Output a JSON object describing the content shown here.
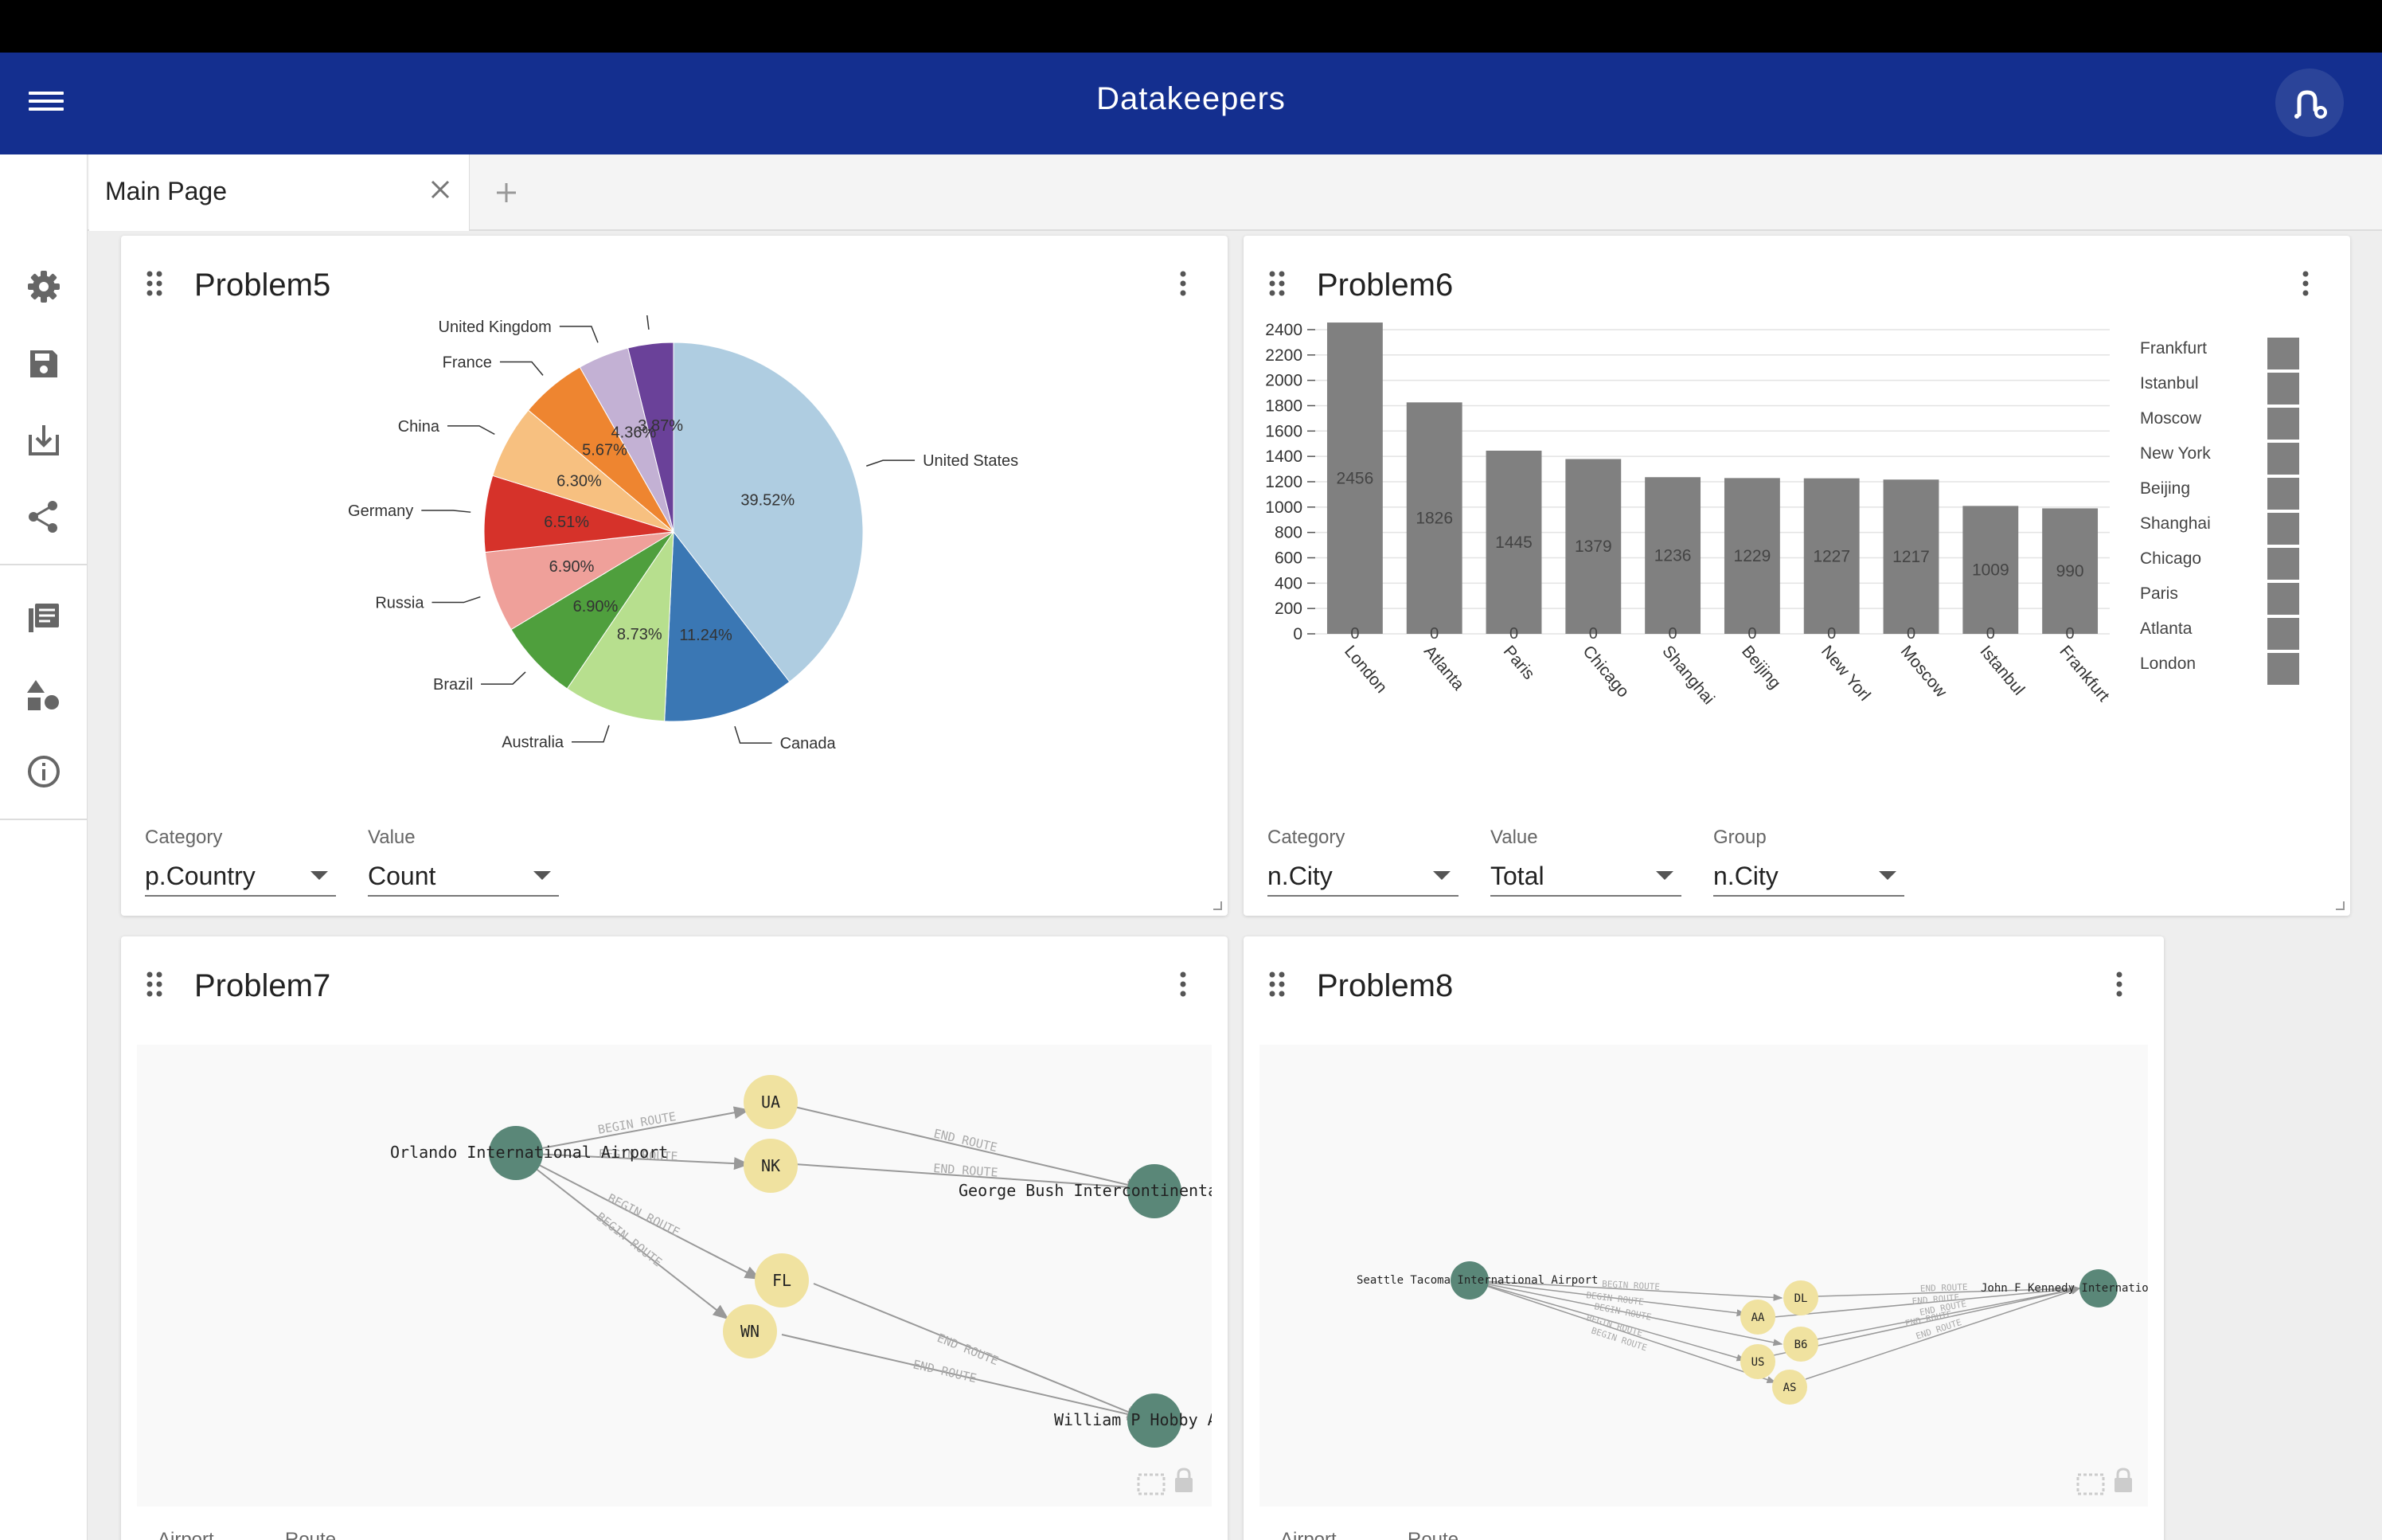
{
  "app": {
    "title": "Datakeepers"
  },
  "tabs": [
    {
      "label": "Main Page"
    }
  ],
  "sidebar": {
    "items": [
      "settings",
      "save",
      "download",
      "share",
      "documentation",
      "extensions",
      "about"
    ]
  },
  "cards": {
    "problem5": {
      "title": "Problem5",
      "fields": [
        {
          "label": "Category",
          "value": "p.Country"
        },
        {
          "label": "Value",
          "value": "Count"
        }
      ]
    },
    "problem6": {
      "title": "Problem6",
      "fields": [
        {
          "label": "Category",
          "value": "n.City"
        },
        {
          "label": "Value",
          "value": "Total"
        },
        {
          "label": "Group",
          "value": "n.City"
        }
      ]
    },
    "problem7": {
      "title": "Problem7",
      "footer": [
        "Airport",
        "Route"
      ],
      "graph": {
        "nodes": [
          {
            "id": "orlando",
            "label": "Orlando International Airport",
            "type": "airport"
          },
          {
            "id": "ua",
            "label": "UA",
            "type": "airline"
          },
          {
            "id": "nk",
            "label": "NK",
            "type": "airline"
          },
          {
            "id": "fl",
            "label": "FL",
            "type": "airline"
          },
          {
            "id": "wn",
            "label": "WN",
            "type": "airline"
          },
          {
            "id": "bush",
            "label": "George Bush Intercontinental",
            "type": "airport"
          },
          {
            "id": "hobby",
            "label": "William P Hobby Ai",
            "type": "airport"
          }
        ],
        "edge_labels": [
          "BEGIN ROUTE",
          "END ROUTE"
        ]
      }
    },
    "problem8": {
      "title": "Problem8",
      "footer": [
        "Airport",
        "Route"
      ],
      "graph": {
        "nodes": [
          {
            "id": "seattle",
            "label": "Seattle Tacoma International Airport",
            "type": "airport"
          },
          {
            "id": "dl",
            "label": "DL",
            "type": "airline"
          },
          {
            "id": "aa",
            "label": "AA",
            "type": "airline"
          },
          {
            "id": "b6",
            "label": "B6",
            "type": "airline"
          },
          {
            "id": "us",
            "label": "US",
            "type": "airline"
          },
          {
            "id": "as",
            "label": "AS",
            "type": "airline"
          },
          {
            "id": "jfk",
            "label": "John F Kennedy International",
            "type": "airport"
          }
        ],
        "edge_labels": [
          "BEGIN ROUTE",
          "END ROUTE"
        ]
      }
    }
  },
  "colors": {
    "header": "#142f8f",
    "airport_node": "#5a8778",
    "airline_node": "#f0e2a0",
    "bar": "#808080"
  },
  "chart_data": [
    {
      "type": "pie",
      "categories": [
        "United States",
        "Canada",
        "Australia",
        "Brazil",
        "Russia",
        "Germany",
        "China",
        "France",
        "United Kingdom",
        ""
      ],
      "values": [
        39.52,
        11.24,
        8.73,
        6.9,
        6.9,
        6.51,
        6.3,
        5.67,
        4.36,
        3.87
      ],
      "value_labels": [
        "39.52%",
        "11.24%",
        "8.73%",
        "6.90%",
        "6.90%",
        "6.51%",
        "6.30%",
        "5.67%",
        "4.36%",
        "3.87%"
      ],
      "colors": [
        "#afcde1",
        "#3a77b4",
        "#b7df8e",
        "#4f9f3d",
        "#efa09a",
        "#d6322a",
        "#f7c080",
        "#ee8530",
        "#c3b1d4",
        "#6a4199"
      ]
    },
    {
      "type": "bar",
      "categories": [
        "London",
        "Atlanta",
        "Paris",
        "Chicago",
        "Shanghai",
        "Beijing",
        "New York",
        "Moscow",
        "Istanbul",
        "Frankfurt"
      ],
      "x_tick_labels": [
        "London",
        "Atlanta",
        "Paris",
        "Chicago",
        "Shanghai",
        "Beijing",
        "New Yorl",
        "Moscow",
        "Istanbul",
        "Frankfurt"
      ],
      "values": [
        2456,
        1826,
        1445,
        1379,
        1236,
        1229,
        1227,
        1217,
        1009,
        990
      ],
      "base_labels": [
        "0",
        "0",
        "0",
        "0",
        "0",
        "0",
        "0",
        "0",
        "0",
        "0"
      ],
      "yticks": [
        0,
        200,
        400,
        600,
        800,
        1000,
        1200,
        1400,
        1600,
        1800,
        2000,
        2200,
        2400
      ],
      "ylim": [
        0,
        2450
      ],
      "legend": [
        "Frankfurt",
        "Istanbul",
        "Moscow",
        "New York",
        "Beijing",
        "Shanghai",
        "Chicago",
        "Paris",
        "Atlanta",
        "London"
      ],
      "legend_position": "right",
      "grid": true
    }
  ]
}
